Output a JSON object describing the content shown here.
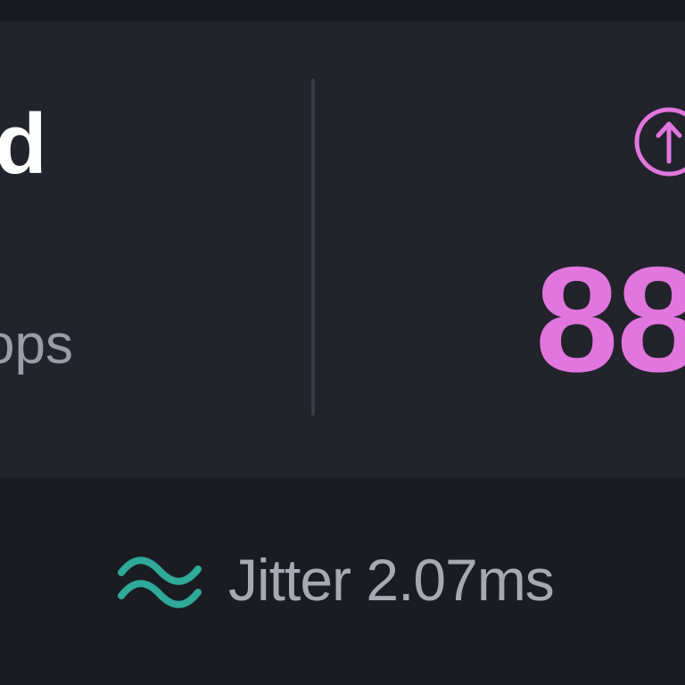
{
  "download": {
    "title_fragment": "d",
    "unit_fragment": "ops"
  },
  "upload": {
    "icon": "arrow-up-circle-icon",
    "value_fragment": "88",
    "color": "#e176de"
  },
  "jitter": {
    "icon": "wave-icon",
    "label": "Jitter 2.07ms",
    "icon_color": "#2fa99a"
  }
}
